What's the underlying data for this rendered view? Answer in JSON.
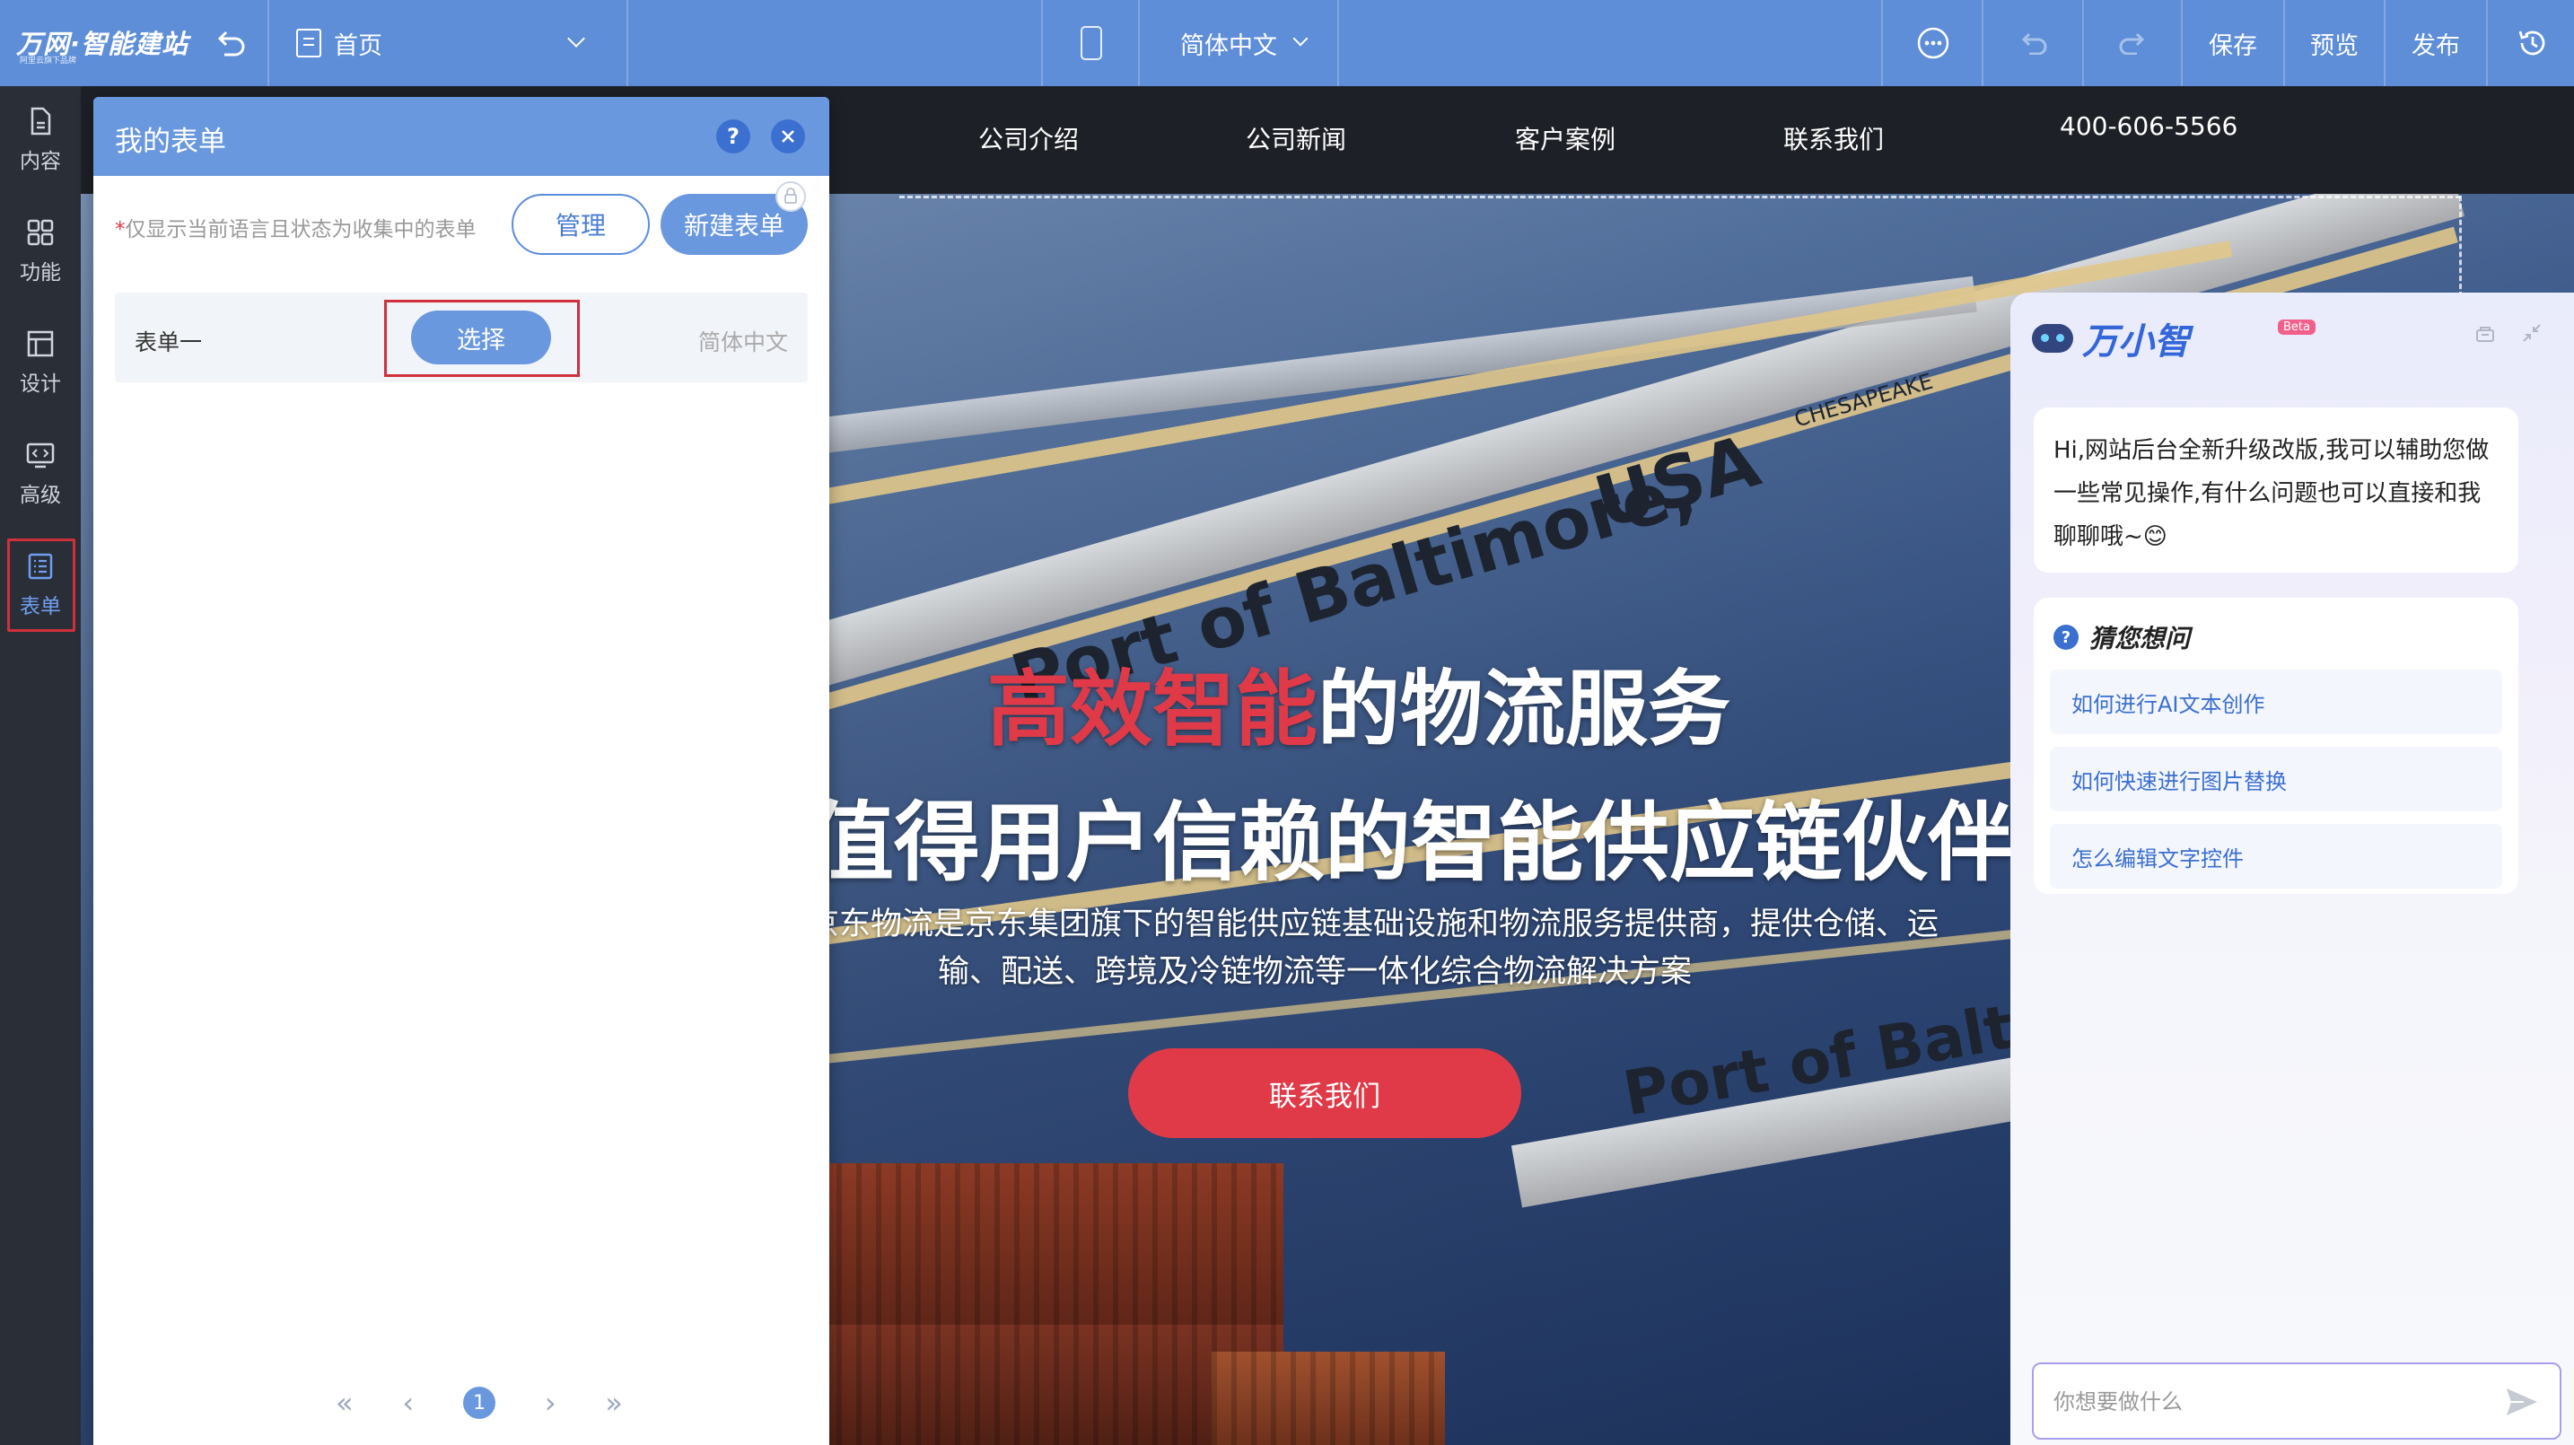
{
  "topbar": {
    "logo": "万网·智能建站",
    "logo_sub": "阿里云旗下品牌",
    "page_selector": "首页",
    "language": "简体中文",
    "save": "保存",
    "preview": "预览",
    "publish": "发布"
  },
  "rail": [
    {
      "label": "内容",
      "icon": "document-icon"
    },
    {
      "label": "功能",
      "icon": "grid-icon"
    },
    {
      "label": "设计",
      "icon": "layout-icon"
    },
    {
      "label": "高级",
      "icon": "code-icon"
    },
    {
      "label": "表单",
      "icon": "form-icon",
      "active": true
    }
  ],
  "site": {
    "nav": [
      "公司介绍",
      "公司新闻",
      "客户案例",
      "联系我们"
    ],
    "phone": "400-606-5566",
    "hero_title_red": "高效智能",
    "hero_title_rest": "的物流服务",
    "hero_subtitle": "值得用户信赖的智能供应链伙伴",
    "hero_desc_1": "京东物流是京东集团旗下的智能供应链基础设施和物流服务提供商，提供仓储、运",
    "hero_desc_2": "输、配送、跨境及冷链物流等一体化综合物流解决方案",
    "hero_button": "联系我们",
    "crane_text_1": "Port of Baltimore,",
    "crane_text_2": "USA",
    "crane_text_3": "Port of Baltim",
    "crane_sign": "CHESAPEAKE"
  },
  "form_panel": {
    "title": "我的表单",
    "help": "?",
    "hint_star": "*",
    "hint": "仅显示当前语言且状态为收集中的表单",
    "manage_button": "管理",
    "new_button": "新建表单",
    "forms": [
      {
        "name": "表单一",
        "action": "选择",
        "language": "简体中文"
      }
    ],
    "pagination": {
      "first": "«",
      "prev": "‹",
      "current": "1",
      "next": "›",
      "last": "»"
    }
  },
  "assistant": {
    "name": "万小智",
    "badge": "Beta",
    "greeting": "Hi,网站后台全新升级改版,我可以辅助您做一些常见操作,有什么问题也可以直接和我聊聊哦~😊",
    "guess_title": "猜您想问",
    "suggestions": [
      "如何进行AI文本创作",
      "如何快速进行图片替换",
      "怎么编辑文字控件"
    ],
    "input_placeholder": "你想要做什么"
  },
  "colors": {
    "toolbar": "#5e8ed8",
    "accent_red": "#e03a48",
    "rail": "#2a2e37"
  }
}
